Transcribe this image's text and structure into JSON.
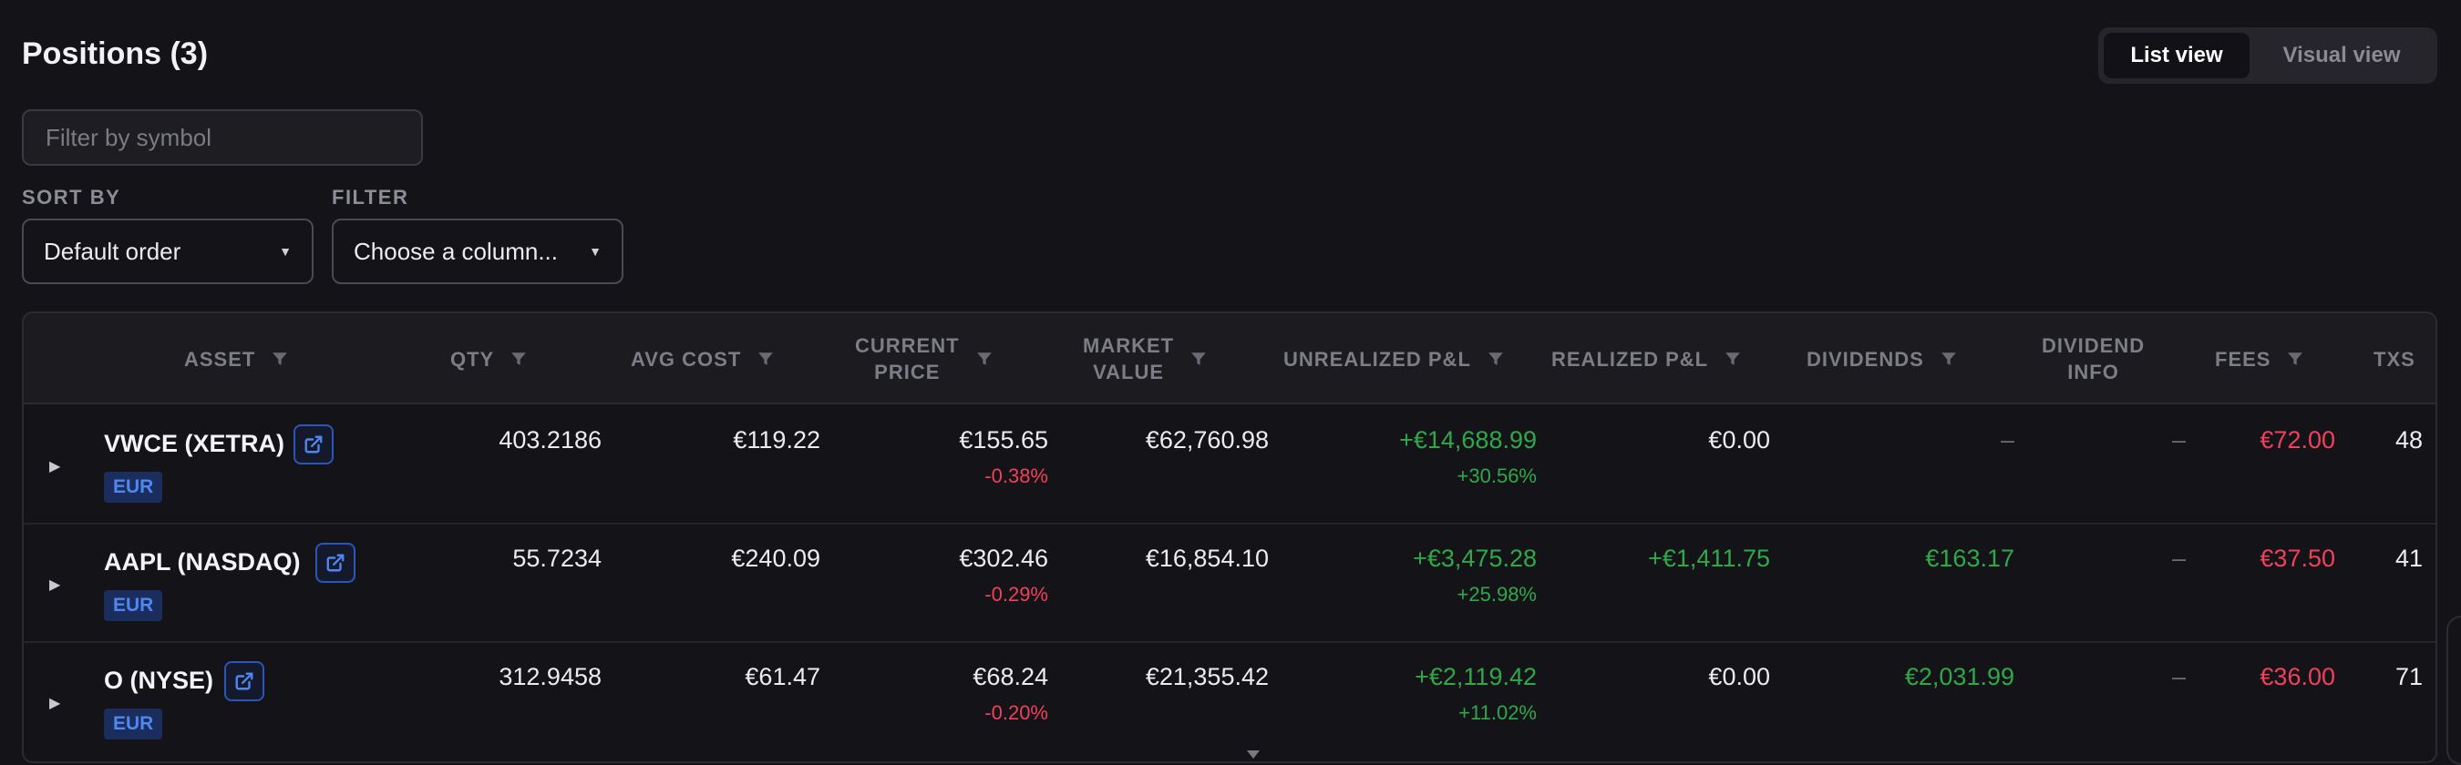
{
  "header": {
    "title": "Positions (3)"
  },
  "view_toggle": {
    "list": "List view",
    "visual": "Visual view"
  },
  "filter_input": {
    "placeholder": "Filter by symbol",
    "value": ""
  },
  "sort": {
    "label": "SORT BY",
    "value": "Default order"
  },
  "filter": {
    "label": "FILTER",
    "value": "Choose a column..."
  },
  "table": {
    "columns": {
      "asset": "ASSET",
      "qty": "QTY",
      "avg_cost": "AVG COST",
      "current_price_1": "CURRENT",
      "current_price_2": "PRICE",
      "market_value_1": "MARKET",
      "market_value_2": "VALUE",
      "unrealized": "UNREALIZED P&L",
      "realized": "REALIZED P&L",
      "dividends": "DIVIDENDS",
      "dividend_info_1": "DIVIDEND",
      "dividend_info_2": "INFO",
      "fees": "FEES",
      "txs": "TXS"
    },
    "rows": [
      {
        "asset": "VWCE (XETRA)",
        "currency": "EUR",
        "qty": "403.2186",
        "avg_cost": "€119.22",
        "price": "€155.65",
        "price_change": "-0.38%",
        "market_value": "€62,760.98",
        "unrealized": "+€14,688.99",
        "unrealized_pct": "+30.56%",
        "realized": "€0.00",
        "dividends": "–",
        "dividend_info": "–",
        "fees": "€72.00",
        "txs": "48"
      },
      {
        "asset": "AAPL (NASDAQ)",
        "currency": "EUR",
        "qty": "55.7234",
        "avg_cost": "€240.09",
        "price": "€302.46",
        "price_change": "-0.29%",
        "market_value": "€16,854.10",
        "unrealized": "+€3,475.28",
        "unrealized_pct": "+25.98%",
        "realized": "+€1,411.75",
        "dividends": "€163.17",
        "dividend_info": "–",
        "fees": "€37.50",
        "txs": "41"
      },
      {
        "asset": "O (NYSE)",
        "currency": "EUR",
        "qty": "312.9458",
        "avg_cost": "€61.47",
        "price": "€68.24",
        "price_change": "-0.20%",
        "market_value": "€21,355.42",
        "unrealized": "+€2,119.42",
        "unrealized_pct": "+11.02%",
        "realized": "€0.00",
        "dividends": "€2,031.99",
        "dividend_info": "–",
        "fees": "€36.00",
        "txs": "71"
      }
    ]
  },
  "colors": {
    "background": "#141418",
    "positive": "#2fa84a",
    "negative": "#f0405c",
    "badge_text": "#4f86f0",
    "link_border": "#2c55b8"
  },
  "icons": {
    "filter_column": "funnel-icon",
    "external_link": "external-link-icon",
    "expand_row": "triangle-right-icon",
    "select_caret": "caret-down-icon"
  }
}
